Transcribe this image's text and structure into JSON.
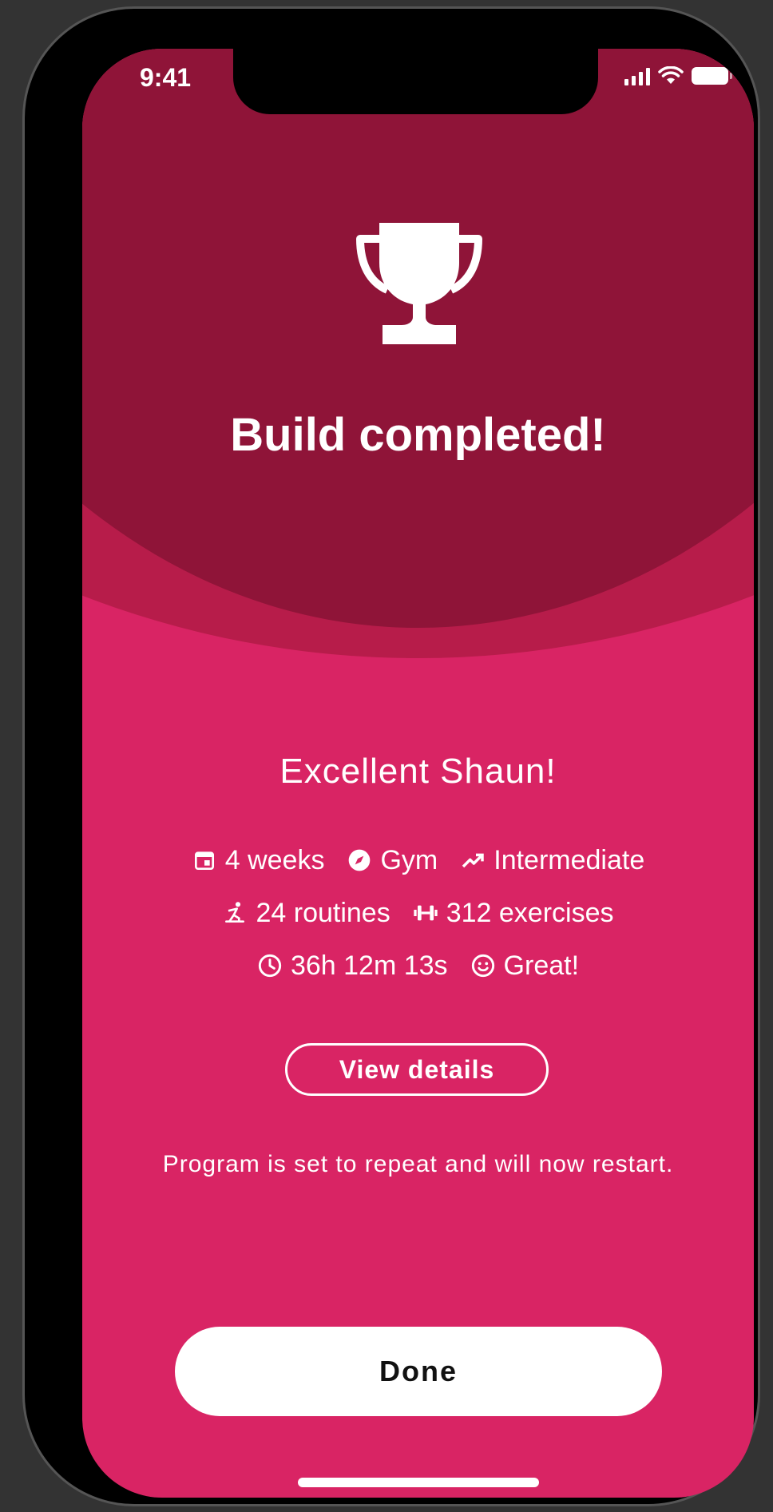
{
  "status_bar": {
    "time": "9:41",
    "signal_icon": "signal-icon",
    "wifi_icon": "wifi-icon",
    "battery_icon": "battery-icon"
  },
  "hero": {
    "icon": "trophy-icon",
    "title": "Build completed!",
    "colors": {
      "inner": "#8f1438",
      "mid": "#b71c4a",
      "background": "#d92464"
    }
  },
  "greeting": "Excellent Shaun!",
  "stats": {
    "duration": {
      "icon": "calendar-icon",
      "label": "4 weeks"
    },
    "location": {
      "icon": "compass-icon",
      "label": "Gym"
    },
    "level": {
      "icon": "trending-up-icon",
      "label": "Intermediate"
    },
    "routines": {
      "icon": "stretch-icon",
      "label": "24 routines"
    },
    "exercises": {
      "icon": "dumbbell-icon",
      "label": "312 exercises"
    },
    "time": {
      "icon": "clock-icon",
      "label": "36h 12m 13s"
    },
    "mood": {
      "icon": "smile-icon",
      "label": "Great!"
    }
  },
  "buttons": {
    "view_details": "View details",
    "done": "Done"
  },
  "repeat_note": "Program is set to repeat and will now restart."
}
